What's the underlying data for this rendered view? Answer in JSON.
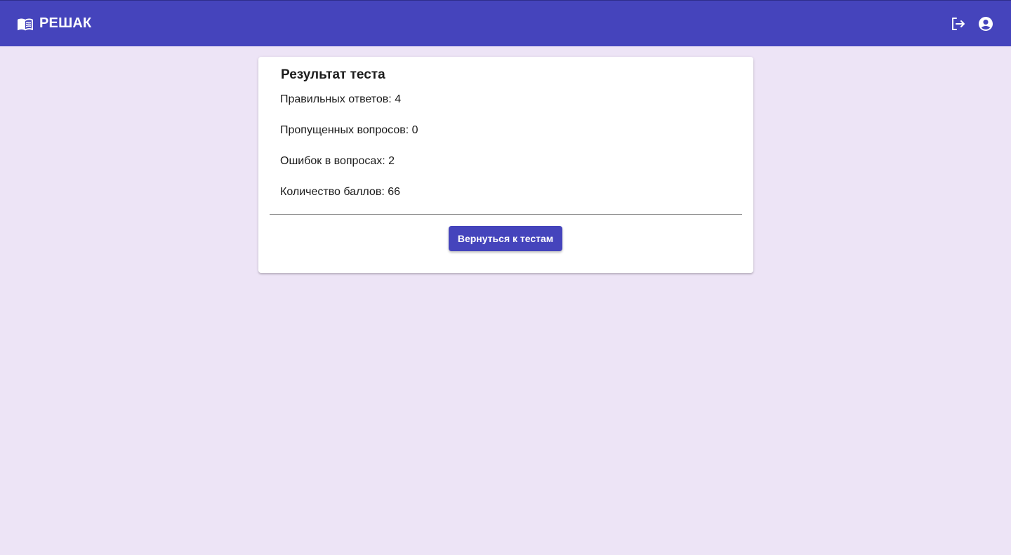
{
  "header": {
    "brand_icon": "open-book-icon",
    "title": "РЕШАК",
    "logout_icon": "logout-icon",
    "account_icon": "account-circle-icon",
    "background_color": "#4544bc"
  },
  "result": {
    "title": "Результат теста",
    "stats": [
      {
        "label": "Правильных ответов",
        "value": 4,
        "text": "Правильных ответов: 4"
      },
      {
        "label": "Пропущенных вопросов",
        "value": 0,
        "text": "Пропущенных вопросов: 0"
      },
      {
        "label": "Ошибок в вопросах",
        "value": 2,
        "text": "Ошибок в вопросах: 2"
      },
      {
        "label": "Количество баллов",
        "value": 66,
        "text": "Количество баллов: 66"
      }
    ],
    "back_button_label": "Вернуться к тестам",
    "accent_color": "#4544bc"
  },
  "page": {
    "background_color": "#ede4f6"
  }
}
